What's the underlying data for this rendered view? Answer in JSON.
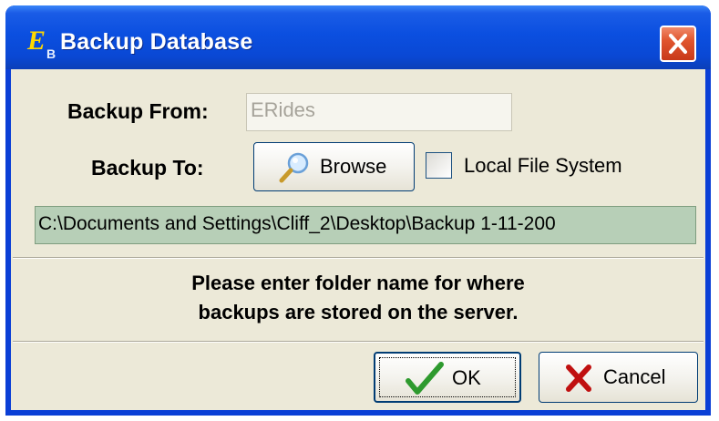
{
  "window": {
    "title": "Backup Database",
    "icon": "eb-app-icon",
    "icon_letter": "E",
    "icon_sub": "B"
  },
  "form": {
    "from_label": "Backup From:",
    "from_value": "ERides",
    "to_label": "Backup To:",
    "browse_label": "Browse",
    "local_fs_label": "Local File System",
    "local_fs_checked": false,
    "path_value": "C:\\Documents and Settings\\Cliff_2\\Desktop\\Backup 1-11-200"
  },
  "message": {
    "line1": "Please enter folder name for where",
    "line2": "backups are stored on the server."
  },
  "buttons": {
    "ok_label": "OK",
    "cancel_label": "Cancel"
  },
  "colors": {
    "titlebar": "#0b4fe0",
    "close_button": "#e0552e",
    "path_field_bg": "#b7cfb7",
    "dialog_bg": "#ece9d8",
    "ok_check": "#2e9a2e",
    "cancel_x": "#c01010"
  }
}
